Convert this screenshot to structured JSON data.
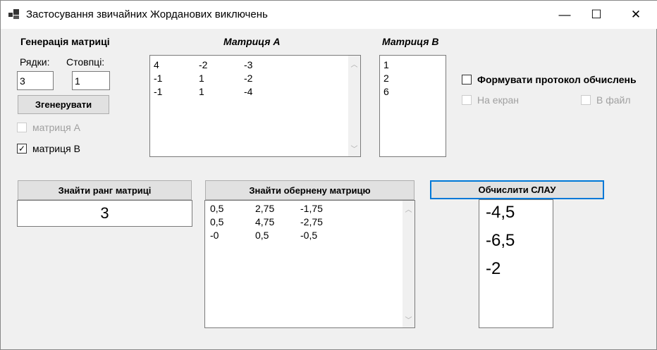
{
  "window": {
    "title": "Застосування звичайних Жорданових виключень",
    "minimize": "—",
    "maximize": "☐",
    "close": "✕"
  },
  "gen": {
    "heading": "Генерація матриці",
    "rows_label": "Рядки:",
    "cols_label": "Стовпці:",
    "rows_value": "3",
    "cols_value": "1",
    "generate": "Згенерувати",
    "matA_label": "матриця А",
    "matA_checked": false,
    "matB_label": "матриця В",
    "matB_checked": true
  },
  "matrixA": {
    "title": "Матриця А",
    "rows": [
      [
        "4",
        "-2",
        "-3"
      ],
      [
        "-1",
        "1",
        "-2"
      ],
      [
        "-1",
        "1",
        "-4"
      ]
    ]
  },
  "matrixB": {
    "title": "Матриця В",
    "values": [
      "1",
      "2",
      "6"
    ]
  },
  "protocol": {
    "label": "Формувати протокол обчислень",
    "screen": "На екран",
    "file": "В файл"
  },
  "rank": {
    "button": "Знайти ранг матриці",
    "value": "3"
  },
  "inverse": {
    "button": "Знайти обернену матрицю",
    "rows": [
      [
        "0,5",
        "2,75",
        "-1,75"
      ],
      [
        "0,5",
        "4,75",
        "-2,75"
      ],
      [
        "-0",
        "0,5",
        "-0,5"
      ]
    ]
  },
  "slau": {
    "button": "Обчислити СЛАУ",
    "values": [
      "-4,5",
      "-6,5",
      "-2"
    ]
  }
}
